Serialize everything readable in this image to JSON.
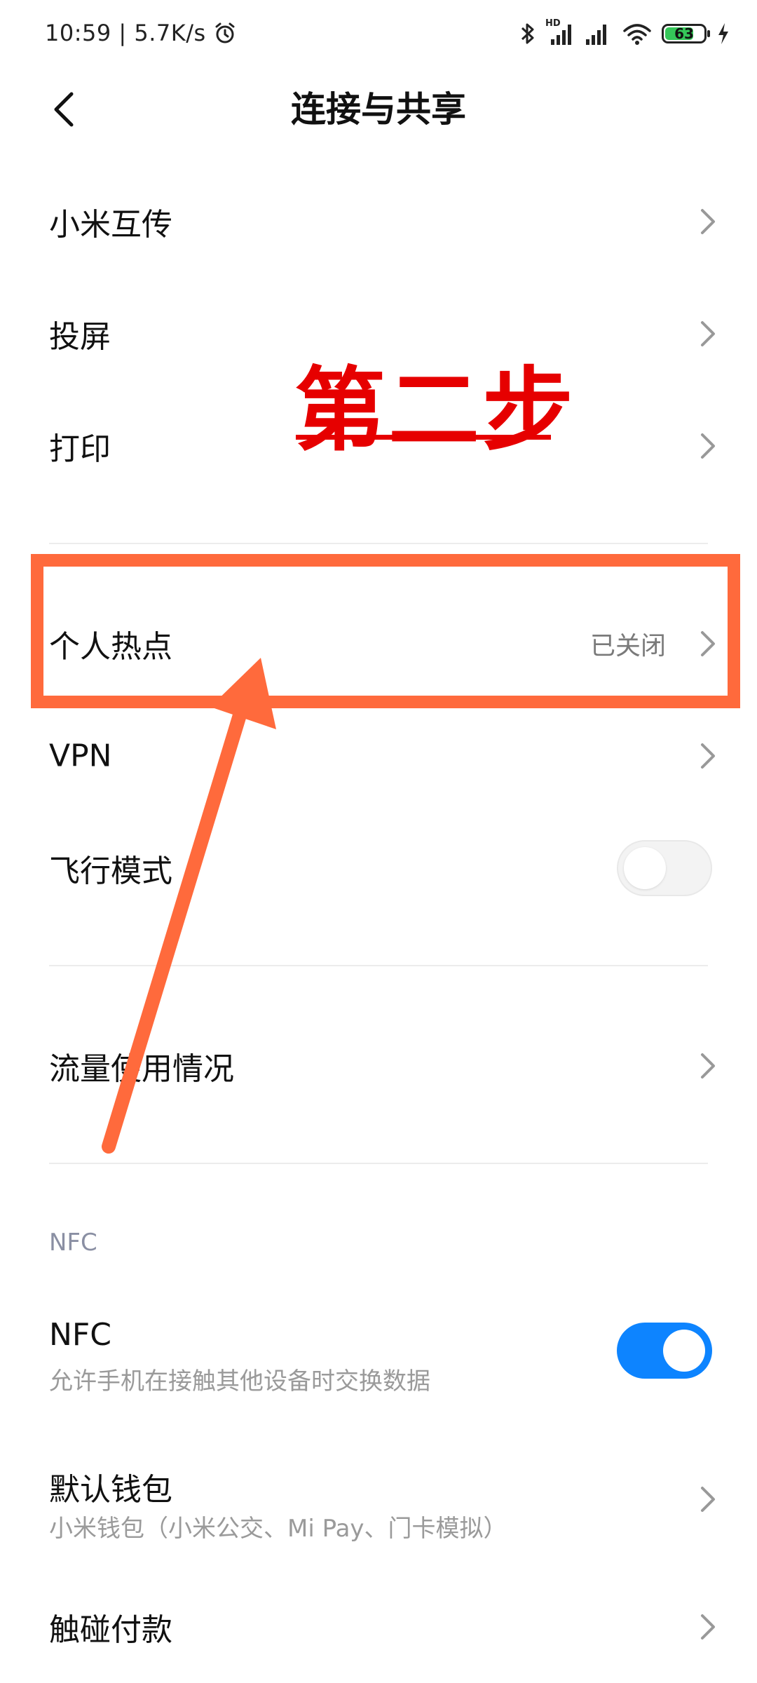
{
  "status_bar": {
    "time_speed": "10:59 | 5.7K/s",
    "network_badge": "HD",
    "battery_level": "63"
  },
  "header": {
    "title": "连接与共享"
  },
  "rows": {
    "mi_share": "小米互传",
    "cast": "投屏",
    "print": "打印",
    "hotspot": {
      "label": "个人热点",
      "value": "已关闭"
    },
    "vpn": "VPN",
    "airplane": {
      "label": "飞行模式",
      "enabled": false
    },
    "data_usage": "流量使用情况"
  },
  "nfc_section": {
    "header": "NFC",
    "nfc": {
      "title": "NFC",
      "subtitle": "允许手机在接触其他设备时交换数据",
      "enabled": true
    },
    "wallet": {
      "title": "默认钱包",
      "subtitle": "小米钱包（小米公交、Mi Pay、门卡模拟）"
    },
    "tap_pay": "触碰付款"
  },
  "annotation": {
    "step_text": "第二步"
  },
  "colors": {
    "toggle_on": "#0d84ff",
    "annotation_red": "#e60000",
    "highlight_orange": "#ff6a3c"
  }
}
